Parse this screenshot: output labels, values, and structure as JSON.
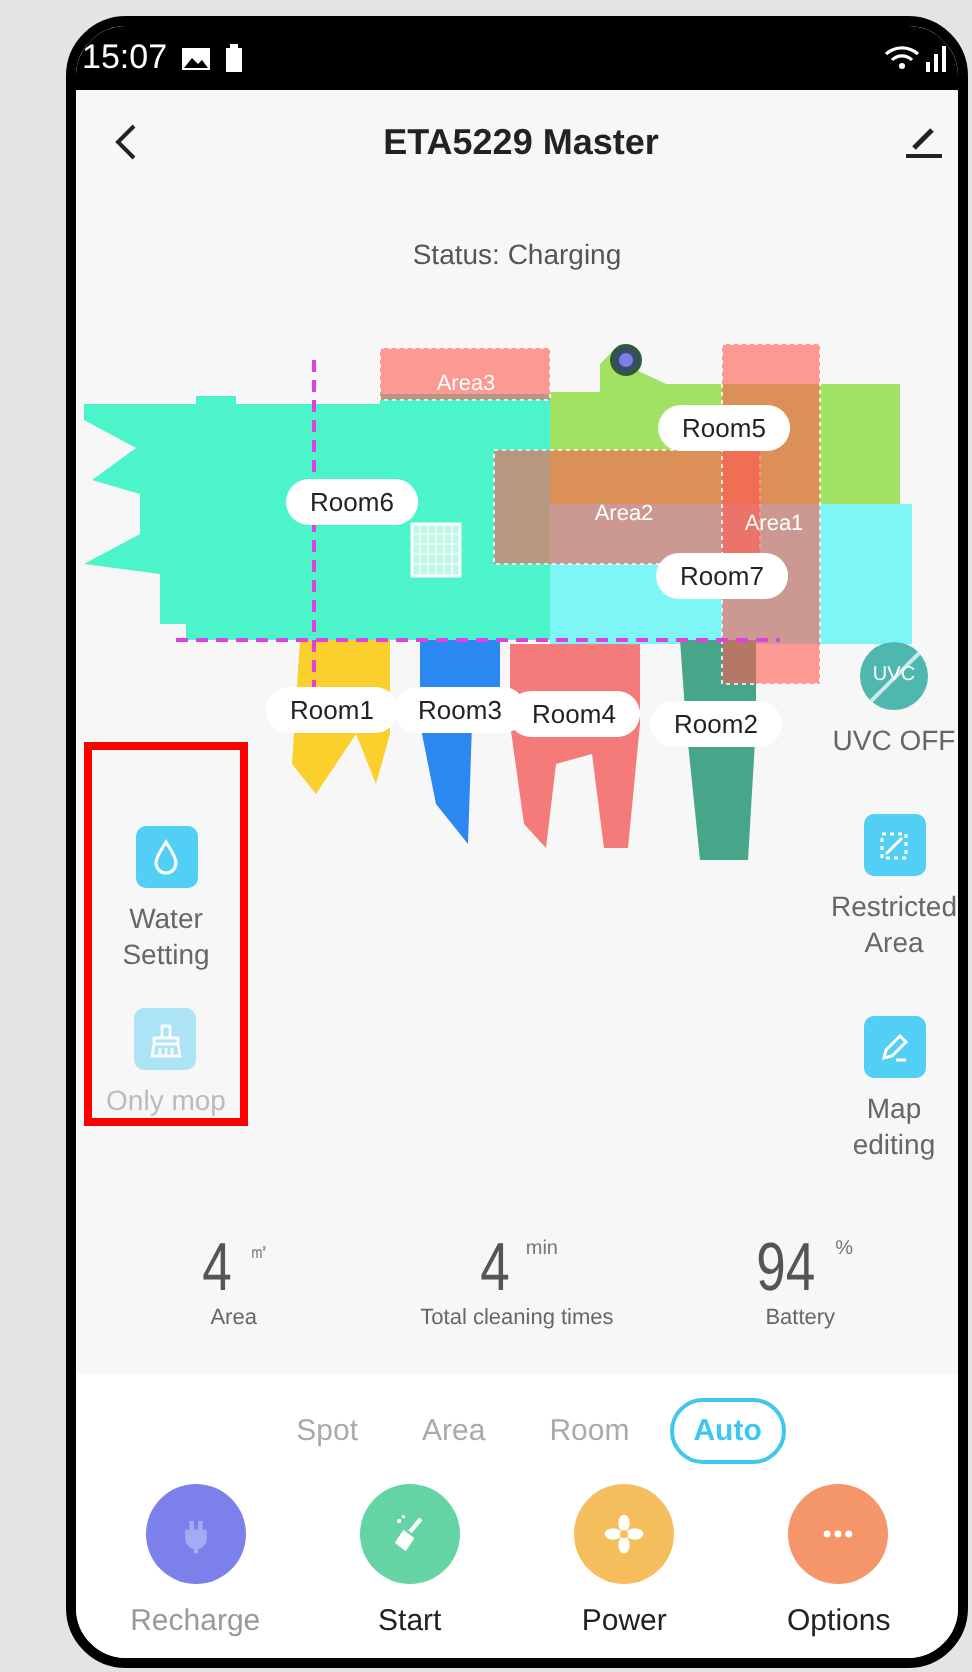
{
  "status_bar": {
    "time": "15:07"
  },
  "header": {
    "title": "ETA5229 Master"
  },
  "status": "Status: Charging",
  "map": {
    "rooms": [
      {
        "label": "Room6",
        "color": "#4cf5c9"
      },
      {
        "label": "Room5",
        "color": "#a2e262"
      },
      {
        "label": "Room7",
        "color": "#7ff6f6"
      },
      {
        "label": "Room1",
        "color": "#fbcf2c"
      },
      {
        "label": "Room3",
        "color": "#2a88f0"
      },
      {
        "label": "Room4",
        "color": "#f57a7a"
      },
      {
        "label": "Room2",
        "color": "#47a58a"
      }
    ],
    "areas": [
      {
        "label": "Area3"
      },
      {
        "label": "Area2"
      },
      {
        "label": "Area1"
      }
    ]
  },
  "left_tools": [
    {
      "kind": "drop",
      "label": "Water Setting",
      "disabled": false
    },
    {
      "kind": "broom",
      "label": "Only mop",
      "disabled": true
    }
  ],
  "right_tools": [
    {
      "kind": "uvc",
      "icon_text": "UVC",
      "label": "UVC OFF",
      "disabled": false
    },
    {
      "kind": "restricted",
      "label": "Restricted Area",
      "disabled": false
    },
    {
      "kind": "edit",
      "label": "Map editing",
      "disabled": false
    }
  ],
  "stats": [
    {
      "value": "4",
      "unit": "㎡",
      "label": "Area"
    },
    {
      "value": "4",
      "unit": "min",
      "label": "Total cleaning times"
    },
    {
      "value": "94",
      "unit": "%",
      "label": "Battery"
    }
  ],
  "modes": [
    {
      "label": "Spot",
      "selected": false
    },
    {
      "label": "Area",
      "selected": false
    },
    {
      "label": "Room",
      "selected": false
    },
    {
      "label": "Auto",
      "selected": true
    }
  ],
  "actions": [
    {
      "kind": "plug",
      "label": "Recharge",
      "color": "#7b80ea",
      "disabled": true
    },
    {
      "kind": "broom",
      "label": "Start",
      "color": "#64d4a4",
      "disabled": false
    },
    {
      "kind": "fan",
      "label": "Power",
      "color": "#f5bd5c",
      "disabled": false
    },
    {
      "kind": "dots",
      "label": "Options",
      "color": "#f4966a",
      "disabled": false
    }
  ]
}
